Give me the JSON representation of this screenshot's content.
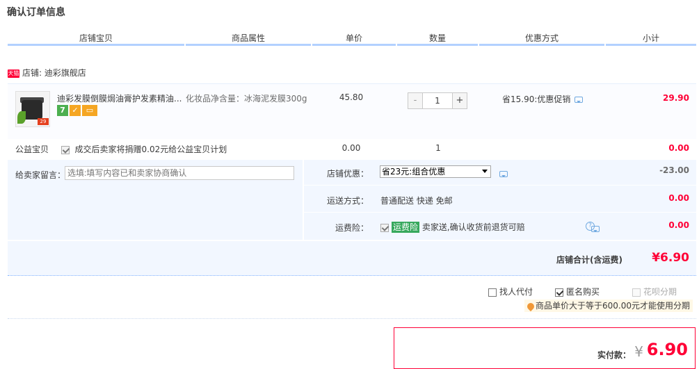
{
  "page": {
    "title": "确认订单信息"
  },
  "table_header": [
    "店铺宝贝",
    "商品属性",
    "单价",
    "数量",
    "优惠方式",
    "小计"
  ],
  "shop": {
    "badge": "天猫",
    "label": "店铺: 迪彩旗舰店"
  },
  "item": {
    "name": "迪彩发膜倒膜焗油膏护发素精油...",
    "attr": "化妆品净含量：冰海泥发膜300g",
    "price": "45.80",
    "quantity": "1",
    "qty_minus": "-",
    "qty_plus": "+",
    "promo": "省15.90:优惠促销",
    "subtotal": "29.90",
    "thumb_tag": "29",
    "service_icons": [
      {
        "name": "seven-day-return-icon",
        "glyph": "7",
        "color": "#4caf50"
      },
      {
        "name": "warranty-icon",
        "glyph": "✓",
        "color": "#f5a623"
      },
      {
        "name": "card-payment-icon",
        "glyph": "▭",
        "color": "#f5a623"
      }
    ]
  },
  "charity": {
    "label": "公益宝贝",
    "text": "成交后卖家将捐赠0.02元给公益宝贝计划",
    "price": "0.00",
    "quantity": "1",
    "subtotal": "0.00"
  },
  "message": {
    "label": "给卖家留言：",
    "placeholder": "选填:填写内容已和卖家协商确认"
  },
  "shop_discount": {
    "label": "店铺优惠：",
    "selected": "省23元:组合优惠",
    "amount": "-23.00"
  },
  "shipping": {
    "label": "运送方式：",
    "value": "普通配送 快递 免邮",
    "amount": "0.00"
  },
  "insurance": {
    "label": "运费险：",
    "badge": "运费险",
    "text": "卖家送,确认收货前退货可赔",
    "amount": "0.00"
  },
  "shop_total": {
    "label": "店铺合计(含运费)",
    "amount": "¥6.90"
  },
  "options": {
    "proxy_pay": "找人代付",
    "anonymous": "匿名购买",
    "huabei": "花呗分期",
    "huabei_note": "商品单价大于等于600.00元才能使用分期"
  },
  "payment": {
    "label": "实付款：",
    "currency": "¥",
    "amount": "6.90"
  },
  "colors": {
    "accent": "#ff0036",
    "panel": "#f2f7ff",
    "header_line": "#b2d1ff"
  }
}
